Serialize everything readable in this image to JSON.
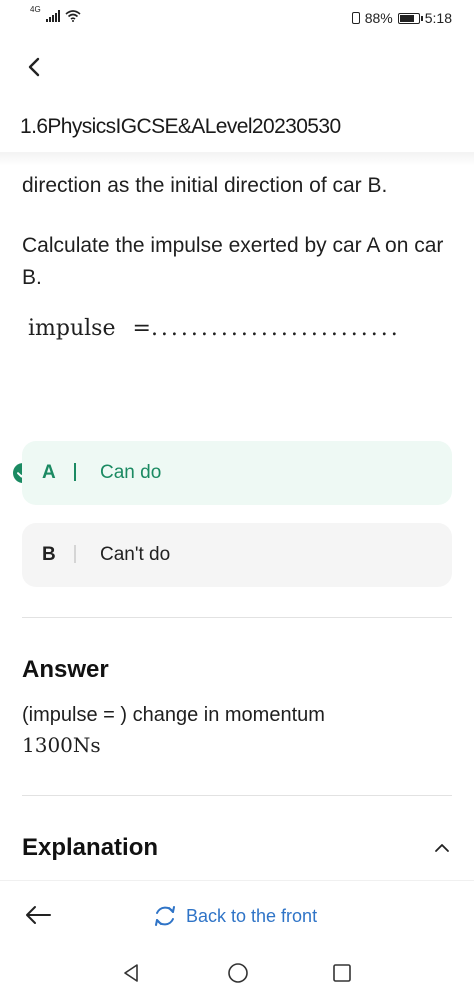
{
  "status_bar": {
    "network": "4G",
    "battery_percent": "88%",
    "battery_level": 0.88,
    "time": "5:18"
  },
  "header": {
    "back_icon": "chevron-left-icon",
    "title": "1.6PhysicsIGCSE&ALevel20230530"
  },
  "question": {
    "line1": "direction as the initial direction of car B.",
    "line2": "Calculate the impulse exerted by car A on car B.",
    "impulse_label": "impulse",
    "impulse_equals": "=",
    "impulse_dots": "........................."
  },
  "options": [
    {
      "letter": "A",
      "label": "Can do",
      "selected": true
    },
    {
      "letter": "B",
      "label": "Can't do",
      "selected": false
    }
  ],
  "answer": {
    "title": "Answer",
    "line1": "(impulse = ) change in momentum",
    "line2": "1300Ns"
  },
  "explanation": {
    "title": "Explanation",
    "toggle_icon": "chevron-up-icon"
  },
  "bottom_bar": {
    "back_icon": "arrow-left-icon",
    "back_front_icon": "refresh-icon",
    "back_front_label": "Back to the front"
  },
  "nav": {
    "back_icon": "triangle-back-icon",
    "home_icon": "circle-home-icon",
    "recent_icon": "square-recent-icon"
  },
  "colors": {
    "accent_green": "#1b8a62",
    "selected_bg": "#eef9f4",
    "link_blue": "#2f74c7"
  }
}
